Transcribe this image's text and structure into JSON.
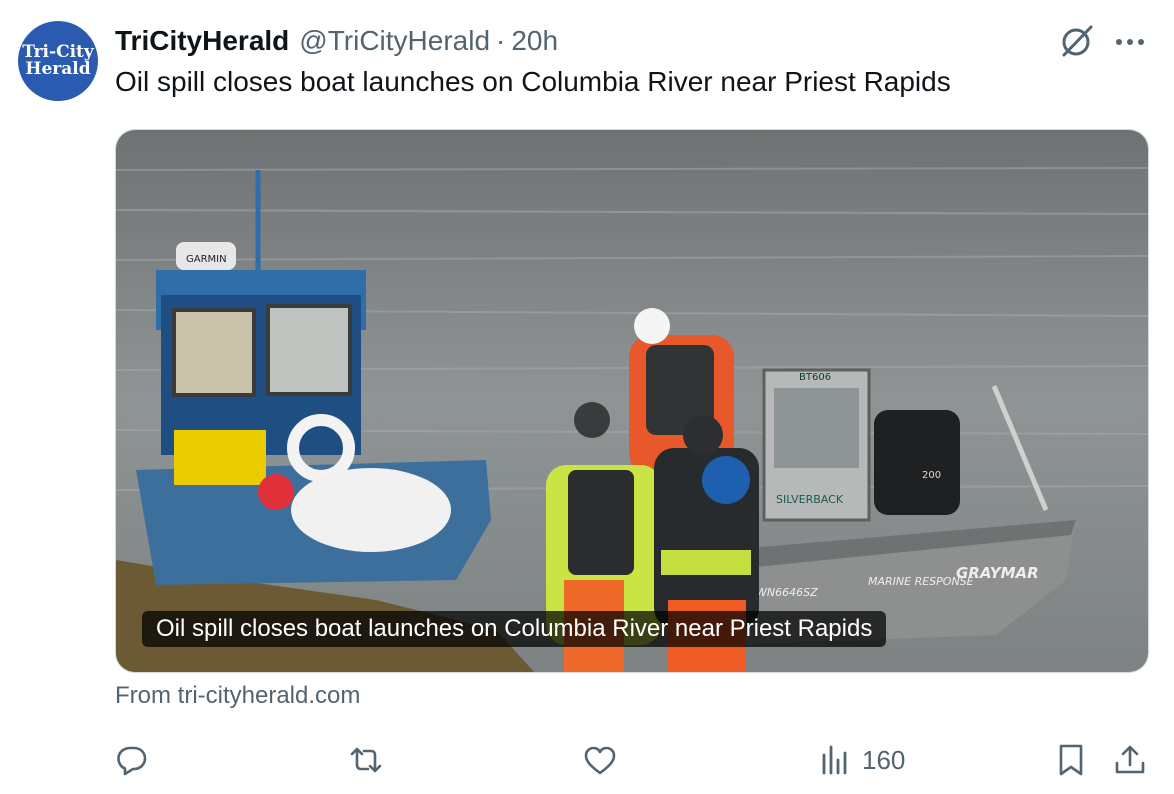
{
  "account": {
    "avatar_text_line1": "Tri-City",
    "avatar_text_line2": "Herald",
    "display_name": "TriCityHerald",
    "handle": "@TriCityHerald",
    "separator": "·",
    "time": "20h"
  },
  "tweet": {
    "text": "Oil spill closes boat launches on Columbia River near Priest Rapids"
  },
  "card": {
    "caption": "Oil spill closes boat launches on Columbia River near Priest Rapids",
    "source": "From tri-cityherald.com",
    "photo_labels": {
      "radar": "GARMIN",
      "boat_id": "BT606",
      "boat_brand": "SILVERBACK",
      "hull_reg": "WN6646SZ",
      "hull_name": "MARINE RESPONSE",
      "hull_maker": "GRAYMAR",
      "motor": "200"
    }
  },
  "actions": {
    "reply_icon": "reply-icon",
    "repost_icon": "repost-icon",
    "like_icon": "heart-icon",
    "views_icon": "views-icon",
    "views_count": "160",
    "bookmark_icon": "bookmark-icon",
    "share_icon": "share-icon"
  },
  "colors": {
    "text_primary": "#0f1419",
    "text_secondary": "#536471",
    "avatar_bg": "#2b5bb0"
  }
}
